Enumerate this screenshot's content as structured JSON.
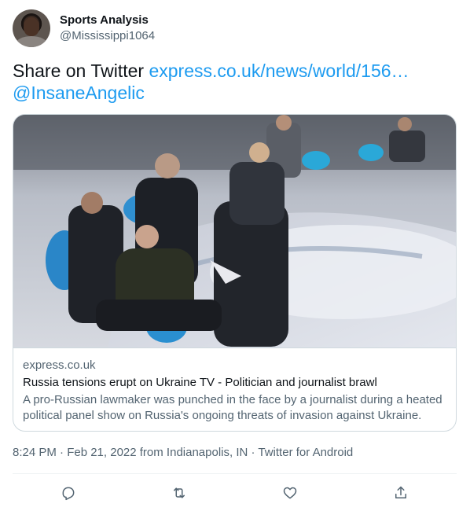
{
  "author": {
    "display_name": "Sports Analysis",
    "handle": "@Mississippi1064",
    "avatar_icon": "profile-avatar"
  },
  "tweet": {
    "prefix": "Share on Twitter ",
    "link": "express.co.uk/news/world/156…",
    "mention": "@InsaneAngelic"
  },
  "card": {
    "domain": "express.co.uk",
    "title": "Russia tensions erupt on Ukraine TV - Politician and journalist brawl",
    "description": "A pro-Russian lawmaker was punched in the face by a journalist during a heated political panel show on Russia's ongoing threats of invasion against Ukraine."
  },
  "meta": {
    "text": "8:24 PM · Feb 21, 2022 from Indianapolis, IN · Twitter for Android"
  },
  "actions": [
    {
      "icon": "reply-icon"
    },
    {
      "icon": "retweet-icon"
    },
    {
      "icon": "like-icon"
    },
    {
      "icon": "share-icon"
    }
  ],
  "colors": {
    "link": "#1d9bf0",
    "secondary_text": "#536471",
    "border": "#cfd9de"
  }
}
